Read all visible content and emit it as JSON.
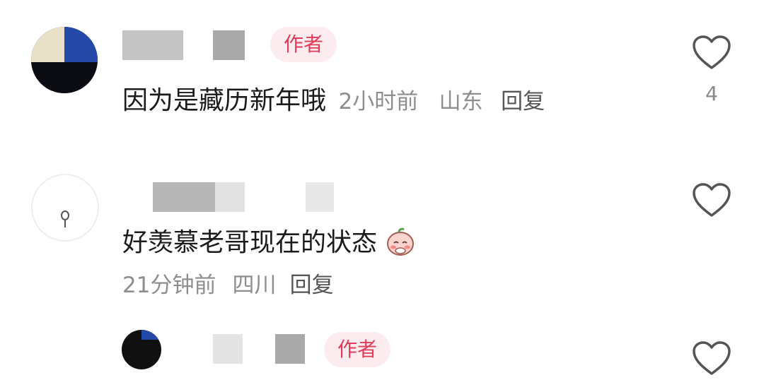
{
  "comments": [
    {
      "badge": "作者",
      "content": "因为是藏历新年哦",
      "time": "2小时前",
      "location": "山东",
      "reply_label": "回复",
      "likes": "4"
    },
    {
      "content": "好羡慕老哥现在的状态",
      "time": "21分钟前",
      "location": "四川",
      "reply_label": "回复",
      "likes": ""
    },
    {
      "badge": "作者",
      "likes": ""
    }
  ],
  "colors": {
    "badge_bg": "#fdecef",
    "badge_text": "#e03c5a",
    "meta_text": "#8e8e8e"
  },
  "icons": {
    "like": "heart-outline-icon",
    "emoji": "blushing-peach-emoji-icon"
  }
}
